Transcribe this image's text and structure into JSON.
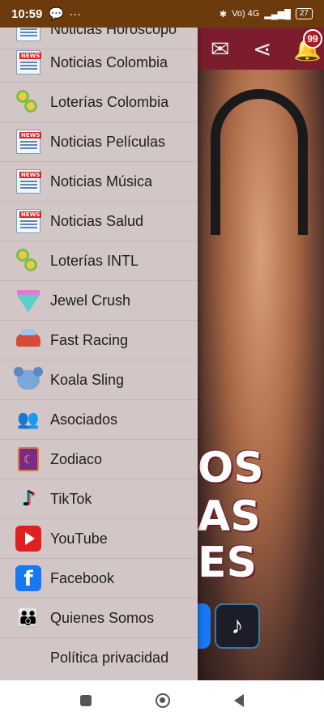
{
  "status_bar": {
    "time": "10:59",
    "network": "Vo) 4G",
    "battery": "27"
  },
  "header": {
    "notification_count": "99"
  },
  "overlay_text": [
    "OS",
    "AS",
    "ES"
  ],
  "drawer": {
    "partial_top_label": "Noticias Horóscopo",
    "items": [
      {
        "label": "Noticias Colombia",
        "icon": "news-icon"
      },
      {
        "label": "Loterías Colombia",
        "icon": "coins-icon"
      },
      {
        "label": "Noticias Películas",
        "icon": "news-icon"
      },
      {
        "label": "Noticias Música",
        "icon": "news-icon"
      },
      {
        "label": "Noticias Salud",
        "icon": "news-icon"
      },
      {
        "label": "Loterías INTL",
        "icon": "coins-icon"
      },
      {
        "label": "Jewel Crush",
        "icon": "jewel-icon"
      },
      {
        "label": "Fast Racing",
        "icon": "car-icon"
      },
      {
        "label": "Koala Sling",
        "icon": "koala-icon"
      },
      {
        "label": "Asociados",
        "icon": "people-icon"
      },
      {
        "label": "Zodiaco",
        "icon": "zodiac-icon"
      },
      {
        "label": "TikTok",
        "icon": "tiktok-icon"
      },
      {
        "label": "YouTube",
        "icon": "youtube-icon"
      },
      {
        "label": "Facebook",
        "icon": "facebook-icon"
      },
      {
        "label": "Quienes Somos",
        "icon": "team-icon"
      },
      {
        "label": "Política privacidad",
        "icon": ""
      }
    ]
  },
  "colors": {
    "status_bar": "#6b3a0d",
    "app_header": "#7b1d2d",
    "drawer_bg": "#d2c6c6",
    "badge": "#b01822",
    "zoom_button": "#e6467a"
  }
}
